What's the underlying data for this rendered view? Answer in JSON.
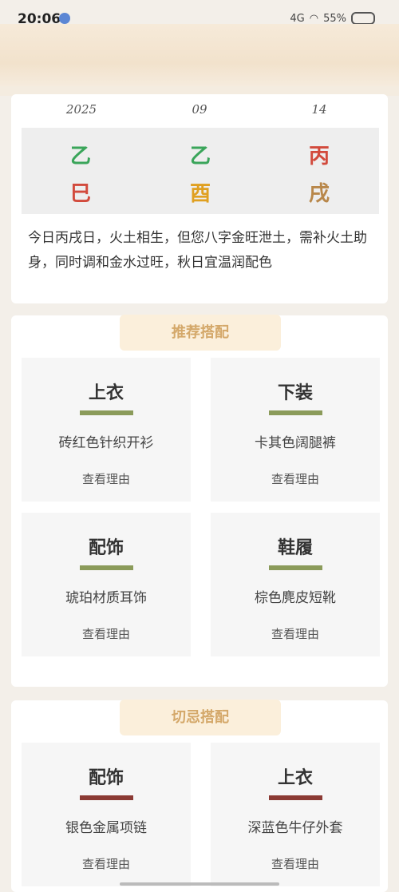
{
  "status_bar": {
    "time": "20:06",
    "network": "4G",
    "battery": "55%"
  },
  "date": {
    "year": "2025",
    "month": "09",
    "day": "14"
  },
  "pillars": [
    {
      "top": "乙",
      "bottom": "巳",
      "top_color": "#3aa55a",
      "bottom_color": "#d24a3c"
    },
    {
      "top": "乙",
      "bottom": "酉",
      "top_color": "#3aa55a",
      "bottom_color": "#e0a020"
    },
    {
      "top": "丙",
      "bottom": "戌",
      "top_color": "#d24a3c",
      "bottom_color": "#b8874a"
    }
  ],
  "description": "今日丙戌日，火土相生，但您八字金旺泄土，需补火土助身，同时调和金水过旺，秋日宜温润配色",
  "recommend": {
    "title": "推荐搭配",
    "accent": "#8b9b5a",
    "items": [
      {
        "category": "上衣",
        "item": "砖红色针织开衫",
        "reason": "查看理由"
      },
      {
        "category": "下装",
        "item": "卡其色阔腿裤",
        "reason": "查看理由"
      },
      {
        "category": "配饰",
        "item": "琥珀材质耳饰",
        "reason": "查看理由"
      },
      {
        "category": "鞋履",
        "item": "棕色麂皮短靴",
        "reason": "查看理由"
      }
    ]
  },
  "avoid": {
    "title": "切忌搭配",
    "accent": "#8b3a34",
    "items": [
      {
        "category": "配饰",
        "item": "银色金属项链",
        "reason": "查看理由"
      },
      {
        "category": "上衣",
        "item": "深蓝色牛仔外套",
        "reason": "查看理由"
      }
    ]
  }
}
